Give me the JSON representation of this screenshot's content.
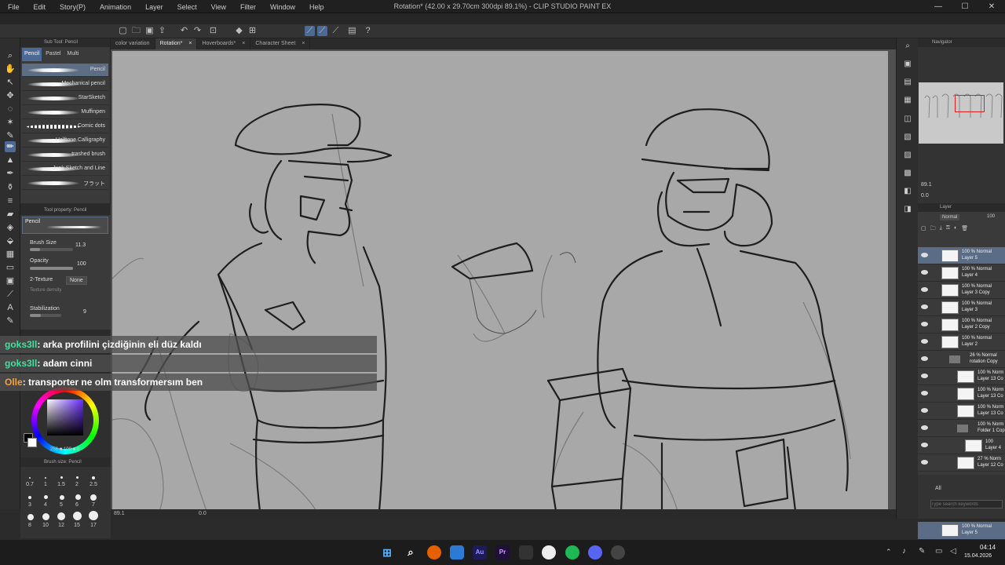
{
  "window": {
    "title": "Rotation* (42.00 x 29.70cm 300dpi 89.1%) - CLIP STUDIO PAINT EX",
    "minimize": "—",
    "maximize": "☐",
    "close": "✕"
  },
  "menu": [
    "File",
    "Edit",
    "Story(P)",
    "Animation",
    "Layer",
    "Select",
    "View",
    "Filter",
    "Window",
    "Help"
  ],
  "subtool": {
    "header": "Sub Tool: Pencil",
    "tabs": [
      "Pencil",
      "Pastel",
      "Multi"
    ],
    "brushes": [
      "Pencil",
      "Mechanical pencil",
      "StarSketch",
      "Muffinpen",
      "Comic dots",
      "Halftone Calligraphy",
      "trashed brush",
      "Junk Sketch and Line",
      "フラット"
    ]
  },
  "tool_property": {
    "header": "Tool property: Pencil",
    "preset": "Pencil",
    "brush_size_label": "Brush Size",
    "brush_size_value": "11.3",
    "brush_size_level": 0.23,
    "opacity_label": "Opacity",
    "opacity_value": "100",
    "opacity_level": 1.0,
    "texture_label": "2-Texture",
    "texture_value": "None",
    "texture_density_label": "Texture density",
    "stabilization_label": "Stabilization",
    "stabilization_value": "9",
    "stabilization_level": 0.35
  },
  "color": {
    "main": "#000000",
    "sub": "#ffffff",
    "readout": "256 ■ 100 ■ 0"
  },
  "brush_size_panel": {
    "header": "Brush size: Pencil",
    "sizes": [
      "0.7",
      "1",
      "1.5",
      "2",
      "2.5",
      "3",
      "4",
      "5",
      "6",
      "7",
      "8",
      "10",
      "12",
      "15",
      "17"
    ]
  },
  "canvas_tabs": [
    {
      "label": "color variation",
      "active": false
    },
    {
      "label": "Rotation*",
      "active": true
    },
    {
      "label": "Hoverboards*",
      "active": false
    },
    {
      "label": "Character Sheet",
      "active": false
    }
  ],
  "canvas_status": {
    "zoom": "89.1",
    "angle": "0.0"
  },
  "chat": [
    {
      "user": "goks3ll",
      "message": ": arka profilini çizdiğinin eli düz kaldı",
      "color": "#43e0a0"
    },
    {
      "user": "goks3ll",
      "message": ": adam cinni",
      "color": "#43e0a0"
    },
    {
      "user": "Olle",
      "message": ": transporter ne olm transformersım ben",
      "color": "#f5a13a"
    }
  ],
  "navigator": {
    "header": "Navigator",
    "zoom": "89.1",
    "angle": "0.0"
  },
  "layers": {
    "header": "Layer",
    "blend_mode": "Normal",
    "opacity": "100",
    "items": [
      {
        "line1": "100 % Normal",
        "line2": "Layer 5",
        "selected": true,
        "indent": 0,
        "folder": false
      },
      {
        "line1": "100 % Normal",
        "line2": "Layer 4",
        "selected": false,
        "indent": 0,
        "folder": false
      },
      {
        "line1": "100 % Normal",
        "line2": "Layer 3 Copy",
        "selected": false,
        "indent": 0,
        "folder": false
      },
      {
        "line1": "100 % Normal",
        "line2": "Layer 3",
        "selected": false,
        "indent": 0,
        "folder": false
      },
      {
        "line1": "100 % Normal",
        "line2": "Layer 2 Copy",
        "selected": false,
        "indent": 0,
        "folder": false
      },
      {
        "line1": "100 % Normal",
        "line2": "Layer 2",
        "selected": false,
        "indent": 0,
        "folder": false
      },
      {
        "line1": "26 % Normal",
        "line2": "rotation Copy",
        "selected": false,
        "indent": 1,
        "folder": true
      },
      {
        "line1": "100 % Norm",
        "line2": "Layer 13 Co",
        "selected": false,
        "indent": 2,
        "folder": false
      },
      {
        "line1": "100 % Norm",
        "line2": "Layer 13 Co",
        "selected": false,
        "indent": 2,
        "folder": false
      },
      {
        "line1": "100 % Norm",
        "line2": "Layer 13 Co",
        "selected": false,
        "indent": 2,
        "folder": false
      },
      {
        "line1": "100 % Norm",
        "line2": "Folder 1 Cop",
        "selected": false,
        "indent": 2,
        "folder": true
      },
      {
        "line1": "100",
        "line2": "Layer 4",
        "selected": false,
        "indent": 3,
        "folder": false
      },
      {
        "line1": "27 % Norm",
        "line2": "Layer 12 Co",
        "selected": false,
        "indent": 2,
        "folder": false
      }
    ],
    "search_placeholder": "Type search keywords",
    "search_filter": "All",
    "search_result_line1": "100 % Normal",
    "search_result_line2": "Layer 5"
  },
  "taskbar": {
    "time": "04:14",
    "date": "15.04.2026",
    "apps": [
      "Au",
      "Pr"
    ]
  }
}
